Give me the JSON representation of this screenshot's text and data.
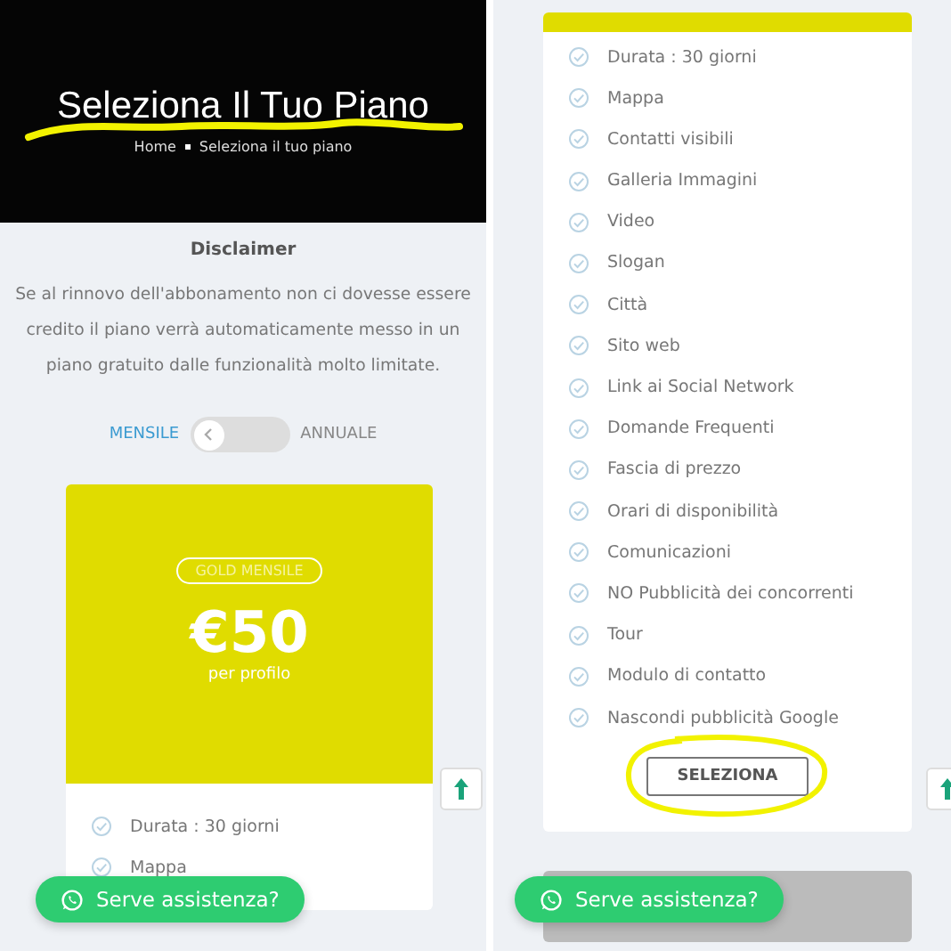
{
  "left": {
    "header": {
      "title": "Seleziona Il Tuo Piano",
      "breadcrumb": [
        "Home",
        "Seleziona il tuo piano"
      ]
    },
    "disclaimer": {
      "title": "Disclaimer",
      "text": "Se al rinnovo dell'abbonamento non ci dovesse essere credito il piano verrà automaticamente messo in un piano gratuito dalle funzionalità molto limitate."
    },
    "billing_toggle": {
      "options": [
        {
          "label": "MENSILE",
          "selected": true
        },
        {
          "label": "ANNUALE",
          "selected": false
        }
      ]
    },
    "plan": {
      "badge": "GOLD MENSILE",
      "price": "€50",
      "unit": "per profilo",
      "features": [
        "Durata : 30 giorni",
        "Mappa"
      ]
    },
    "chat_button": "Serve assistenza?"
  },
  "right": {
    "features": [
      "Durata : 30 giorni",
      "Mappa",
      "Contatti visibili",
      "Galleria Immagini",
      "Video",
      "Slogan",
      "Città",
      "Sito web",
      "Link ai Social Network",
      "Domande Frequenti",
      "Fascia di prezzo",
      "Orari di disponibilità",
      "Comunicazioni",
      "NO Pubblicità dei concorrenti",
      "Tour",
      "Modulo di contatto",
      "Nascondi pubblicità Google"
    ],
    "select_button": "SELEZIONA",
    "chat_button": "Serve assistenza?"
  }
}
